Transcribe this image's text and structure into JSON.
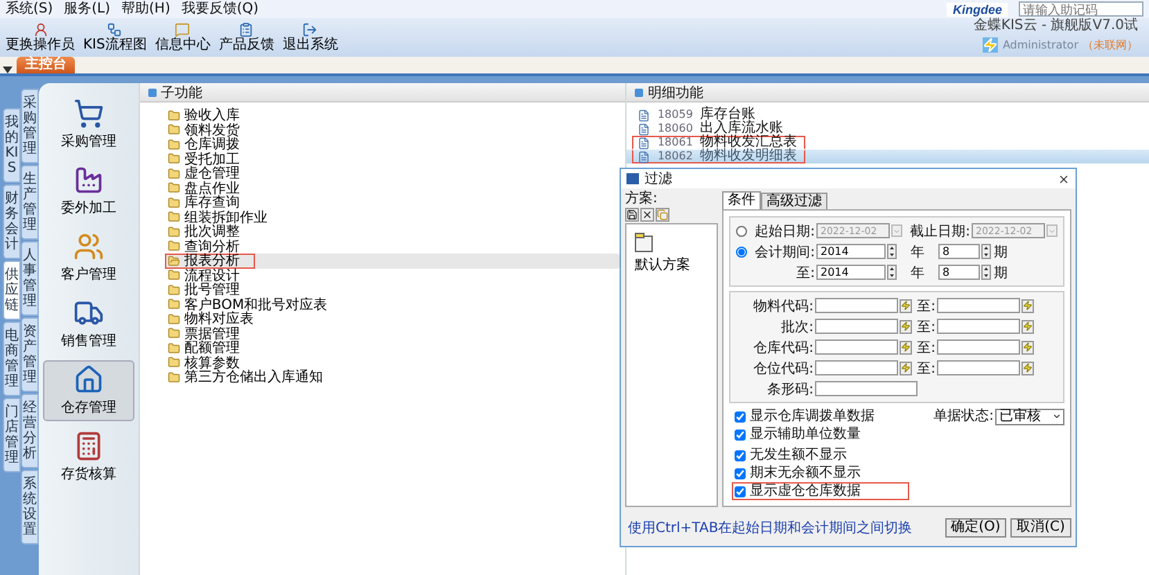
{
  "menu": [
    "系统(S)",
    "服务(L)",
    "帮助(H)",
    "我要反馈(Q)"
  ],
  "brand": {
    "logo": "Kingdee",
    "search": {
      "placeholder": "请输入助记码"
    }
  },
  "toolbar": [
    "更换操作员",
    "KIS流程图",
    "信息中心",
    "产品反馈",
    "退出系统"
  ],
  "product": "金蝶KIS云 - 旗舰版V7.0试",
  "user": {
    "name": "Administrator",
    "status": "（未联网）"
  },
  "tabs": [
    {
      "label": "主控台",
      "selected": true
    }
  ],
  "nav_groups": [
    {
      "label": "我的KIS",
      "selected": false
    },
    {
      "label": "财务会计",
      "selected": false
    },
    {
      "label": "供应链",
      "selected": true
    },
    {
      "label": "电商管理",
      "selected": false
    },
    {
      "label": "门店管理",
      "selected": false
    }
  ],
  "nav_sub": [
    {
      "label": "采购管理",
      "selected": false
    },
    {
      "label": "生产管理",
      "selected": false
    },
    {
      "label": "人事管理",
      "selected": false
    },
    {
      "label": "资产管理",
      "selected": false
    },
    {
      "label": "经营分析",
      "selected": false
    },
    {
      "label": "系统设置",
      "selected": false
    }
  ],
  "modules": [
    {
      "label": "采购管理",
      "selected": false
    },
    {
      "label": "委外加工",
      "selected": false
    },
    {
      "label": "客户管理",
      "selected": false
    },
    {
      "label": "销售管理",
      "selected": false
    },
    {
      "label": "仓存管理",
      "selected": true
    },
    {
      "label": "存货核算",
      "selected": false
    }
  ],
  "sub_functions": {
    "title": "子功能",
    "items": [
      {
        "label": "验收入库",
        "selected": false,
        "highlighted": false
      },
      {
        "label": "领料发货",
        "selected": false,
        "highlighted": false
      },
      {
        "label": "仓库调拨",
        "selected": false,
        "highlighted": false
      },
      {
        "label": "受托加工",
        "selected": false,
        "highlighted": false
      },
      {
        "label": "虚仓管理",
        "selected": false,
        "highlighted": false
      },
      {
        "label": "盘点作业",
        "selected": false,
        "highlighted": false
      },
      {
        "label": "库存查询",
        "selected": false,
        "highlighted": false
      },
      {
        "label": "组装拆卸作业",
        "selected": false,
        "highlighted": false
      },
      {
        "label": "批次调整",
        "selected": false,
        "highlighted": false
      },
      {
        "label": "查询分析",
        "selected": false,
        "highlighted": false
      },
      {
        "label": "报表分析",
        "selected": true,
        "highlighted": true
      },
      {
        "label": "流程设计",
        "selected": false,
        "highlighted": false
      },
      {
        "label": "批号管理",
        "selected": false,
        "highlighted": false
      },
      {
        "label": "客户BOM和批号对应表",
        "selected": false,
        "highlighted": false
      },
      {
        "label": "物料对应表",
        "selected": false,
        "highlighted": false
      },
      {
        "label": "票据管理",
        "selected": false,
        "highlighted": false
      },
      {
        "label": "配额管理",
        "selected": false,
        "highlighted": false
      },
      {
        "label": "核算参数",
        "selected": false,
        "highlighted": false
      },
      {
        "label": "第三方仓储出入库通知",
        "selected": false,
        "highlighted": false
      }
    ]
  },
  "detail": {
    "title": "明细功能",
    "items": [
      {
        "code": "18059",
        "label": "库存台账",
        "selected": false,
        "highlighted": false
      },
      {
        "code": "18060",
        "label": "出入库流水账",
        "selected": false,
        "highlighted": false
      },
      {
        "code": "18061",
        "label": "物料收发汇总表",
        "selected": false,
        "highlighted": true
      },
      {
        "code": "18062",
        "label": "物料收发明细表",
        "selected": true,
        "highlighted": true
      }
    ]
  },
  "dialog": {
    "title": "过滤",
    "scheme_label": "方案:",
    "schemes": [
      {
        "label": "默认方案"
      }
    ],
    "tabs": [
      {
        "label": "条件",
        "selected": true
      },
      {
        "label": "高级过滤",
        "selected": false
      }
    ],
    "date_row": {
      "label": "起始日期:",
      "selected": false,
      "start": "2022-12-02",
      "end_label": "截止日期:",
      "end": "2022-12-02"
    },
    "period_rows": [
      {
        "kind": "radio",
        "label": "会计期间:",
        "selected": true,
        "year": "2014",
        "year_unit": "年",
        "period": "8",
        "period_unit": "期"
      },
      {
        "kind": "plain",
        "label": "至:",
        "year": "2014",
        "year_unit": "年",
        "period": "8",
        "period_unit": "期"
      }
    ],
    "code_rows": [
      {
        "kind": "range",
        "label": "物料代码:",
        "to_label": "至:"
      },
      {
        "kind": "range",
        "label": "批次:",
        "to_label": "至:"
      },
      {
        "kind": "range",
        "label": "仓库代码:",
        "to_label": "至:"
      },
      {
        "kind": "range",
        "label": "仓位代码:",
        "to_label": "至:"
      },
      {
        "kind": "single",
        "label": "条形码:"
      }
    ],
    "options": [
      {
        "label": "显示仓库调拨单数据",
        "checked": true,
        "highlighted": false
      },
      {
        "label": "显示辅助单位数量",
        "checked": true,
        "highlighted": false
      },
      {
        "label": "无发生额不显示",
        "checked": true,
        "highlighted": false
      },
      {
        "label": "期末无余额不显示",
        "checked": true,
        "highlighted": false
      },
      {
        "label": "显示虚仓仓库数据",
        "checked": true,
        "highlighted": true
      }
    ],
    "status": {
      "label": "单据状态:",
      "value": "已审核"
    },
    "hint": "使用Ctrl+TAB在起始日期和会计期间之间切换",
    "buttons": [
      "确定(O)",
      "取消(C)"
    ]
  }
}
